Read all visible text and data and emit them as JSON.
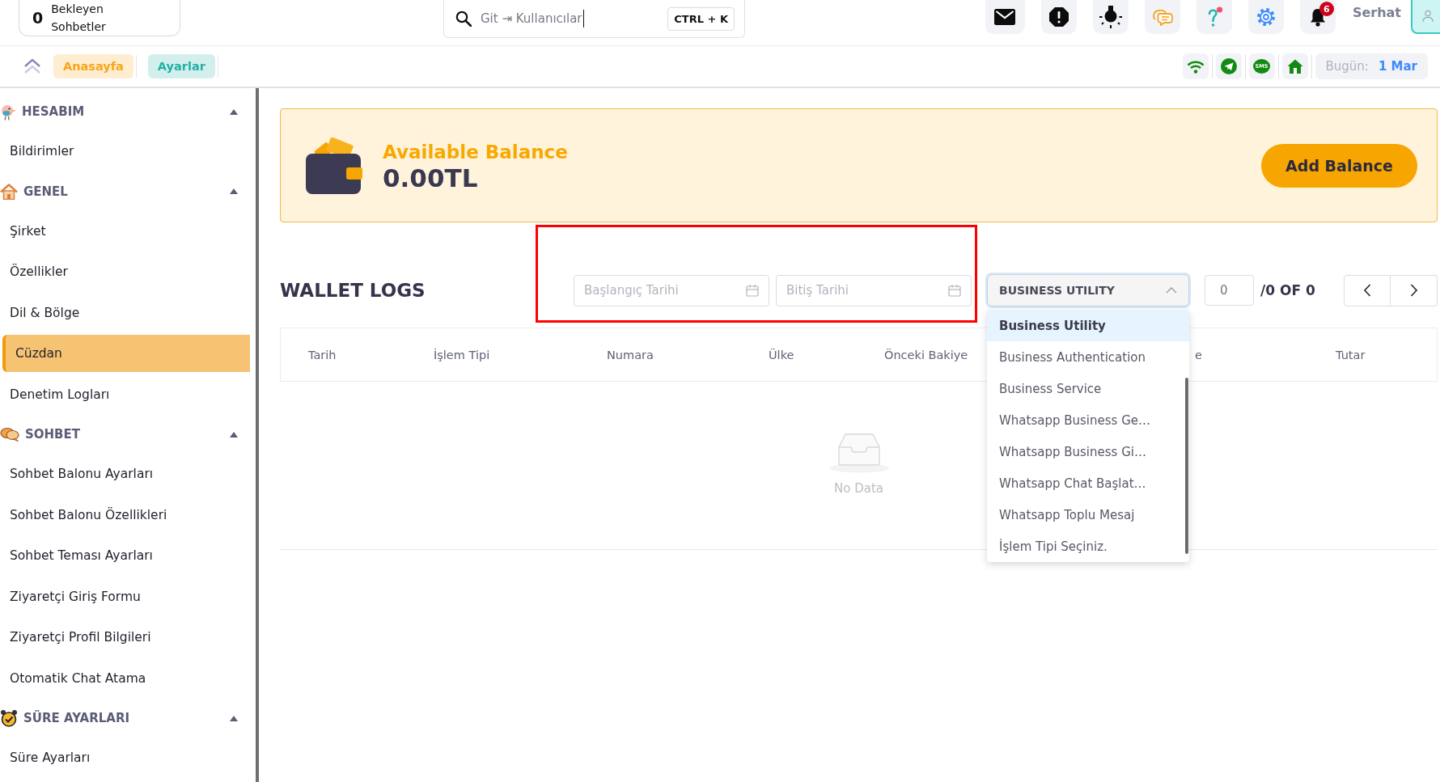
{
  "header": {
    "pending_chats": {
      "count": "0",
      "label": "Bekleyen Sohbetler"
    },
    "search": {
      "value": "Git ⇥ Kullanıcılar",
      "shortcut": "CTRL + K"
    },
    "notification_badge": "6",
    "user_name": "Serhat"
  },
  "breadcrumb": [
    {
      "label": "Anasayfa",
      "color": "#f9a51a"
    },
    {
      "label": "Ayarlar",
      "color": "#22b0a6"
    }
  ],
  "status_bar": {
    "sms_label": "SMS",
    "today_label": "Bugün:",
    "today_value": "1 Mar"
  },
  "sidebar": {
    "sections": [
      {
        "title": "HESABIM",
        "expanded": true,
        "children": [
          {
            "label": "Bildirimler",
            "selected": false
          }
        ]
      },
      {
        "title": "GENEL",
        "expanded": true,
        "children": [
          {
            "label": "Şirket",
            "selected": false
          },
          {
            "label": "Özellikler",
            "selected": false
          },
          {
            "label": "Dil & Bölge",
            "selected": false
          },
          {
            "label": "Cüzdan",
            "selected": true
          },
          {
            "label": "Denetim Logları",
            "selected": false
          }
        ]
      },
      {
        "title": "SOHBET",
        "expanded": true,
        "children": [
          {
            "label": "Sohbet Balonu Ayarları",
            "selected": false
          },
          {
            "label": "Sohbet Balonu Özellikleri",
            "selected": false
          },
          {
            "label": "Sohbet Teması Ayarları",
            "selected": false
          },
          {
            "label": "Ziyaretçi Giriş Formu",
            "selected": false
          },
          {
            "label": "Ziyaretçi Profil Bilgileri",
            "selected": false
          },
          {
            "label": "Otomatik Chat Atama",
            "selected": false
          }
        ]
      },
      {
        "title": "SÜRE AYARLARI",
        "expanded": true,
        "children": [
          {
            "label": "Süre Ayarları",
            "selected": false
          }
        ]
      }
    ]
  },
  "balance_card": {
    "title": "Available Balance",
    "amount": "0.00TL",
    "button": "Add Balance"
  },
  "wallet_logs": {
    "title": "WALLET LOGS",
    "start_date": {
      "placeholder": "Başlangıç Tarihi"
    },
    "end_date": {
      "placeholder": "Bitiş Tarihi"
    },
    "type_select": {
      "value": "BUSINESS UTILITY",
      "expanded": true,
      "options": [
        {
          "label": "Business Utility",
          "selected": true
        },
        {
          "label": "Business Authentication",
          "selected": false
        },
        {
          "label": "Business Service",
          "selected": false
        },
        {
          "label": "Whatsapp Business Ge…",
          "selected": false
        },
        {
          "label": "Whatsapp Business Gi…",
          "selected": false
        },
        {
          "label": "Whatsapp Chat Başlat…",
          "selected": false
        },
        {
          "label": "Whatsapp Toplu Mesaj",
          "selected": false
        },
        {
          "label": "İşlem Tipi Seçiniz.",
          "selected": false
        }
      ]
    },
    "pagination": {
      "page": "0",
      "total": "/0 OF 0"
    },
    "table": {
      "columns": [
        "Tarih",
        "İşlem Tipi",
        "Numara",
        "Ülke",
        "Önceki Bakiye",
        "e",
        "Tutar"
      ],
      "empty_text": "No Data"
    }
  }
}
